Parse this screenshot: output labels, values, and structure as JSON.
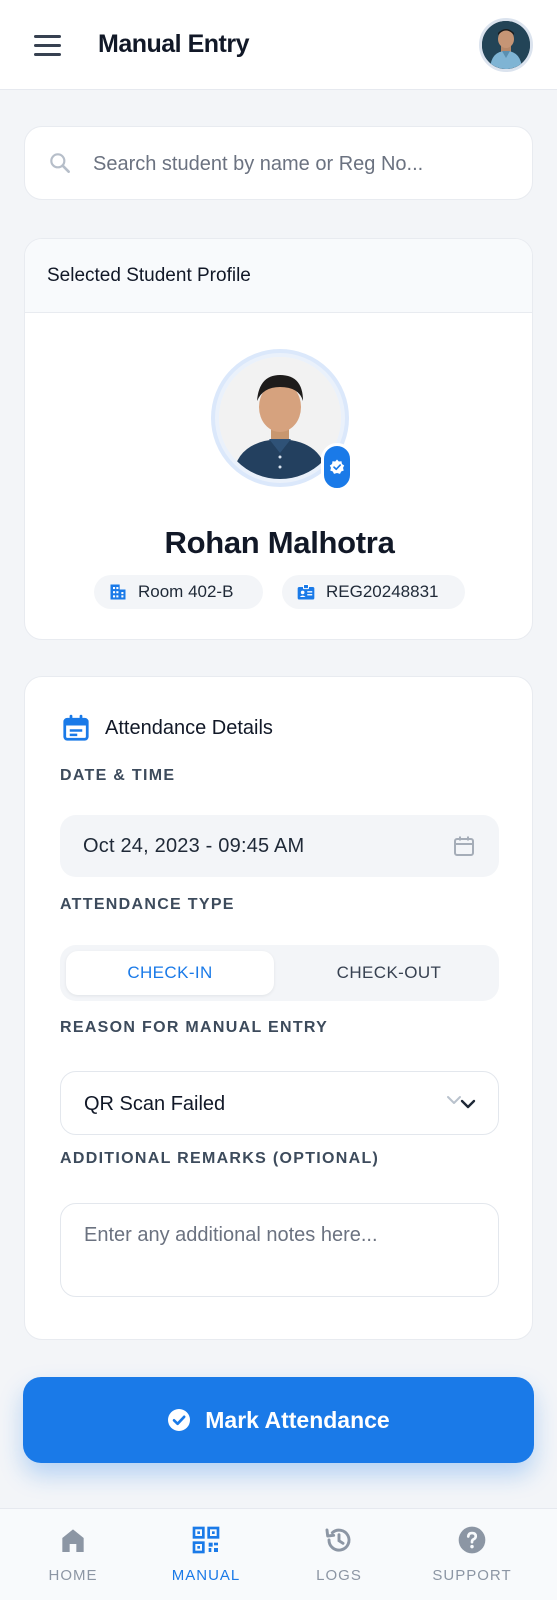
{
  "header": {
    "title": "Manual Entry",
    "menu_icon": "hamburger-menu-icon",
    "avatar": "user-avatar"
  },
  "search": {
    "placeholder": "Search student by name or Reg No...",
    "value": ""
  },
  "profile": {
    "section_title": "Selected Student Profile",
    "name": "Rohan Malhotra",
    "room": "Room 402-B",
    "reg_no": "REG20248831",
    "verified": true
  },
  "attendance": {
    "section_title": "Attendance Details",
    "date_label": "DATE & TIME",
    "date_value": "Oct 24, 2023 - 09:45 AM",
    "type_label": "ATTENDANCE TYPE",
    "type_options": [
      "CHECK-IN",
      "CHECK-OUT"
    ],
    "type_selected": "CHECK-IN",
    "reason_label": "REASON FOR MANUAL ENTRY",
    "reason_value": "QR Scan Failed",
    "remarks_label": "ADDITIONAL REMARKS (OPTIONAL)",
    "remarks_placeholder": "Enter any additional notes here...",
    "remarks_value": ""
  },
  "submit": {
    "label": "Mark Attendance"
  },
  "nav": {
    "items": [
      {
        "label": "HOME",
        "icon": "home-icon",
        "active": false
      },
      {
        "label": "MANUAL",
        "icon": "qr-code-icon",
        "active": true
      },
      {
        "label": "LOGS",
        "icon": "history-icon",
        "active": false
      },
      {
        "label": "SUPPORT",
        "icon": "help-icon",
        "active": false
      }
    ]
  },
  "colors": {
    "accent": "#1a7ae8",
    "background": "#f3f5f8",
    "text": "#111827",
    "muted": "#6b7280"
  }
}
